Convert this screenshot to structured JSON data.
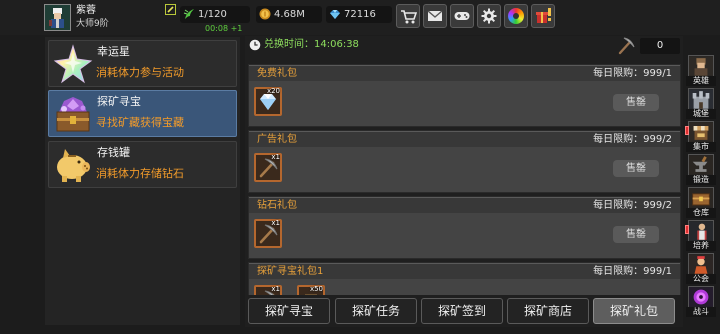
{
  "player": {
    "name": "紫蓉",
    "rank": "大师9阶",
    "icon": "hero-avatar-icon"
  },
  "resources": {
    "stamina": {
      "value": "1/120",
      "regen": "00:08 +1",
      "icon": "stamina-icon"
    },
    "gold": {
      "value": "4.68M",
      "icon": "gold-coin-icon"
    },
    "gems": {
      "value": "72116",
      "icon": "gem-icon"
    }
  },
  "toolbar_icons": [
    "shop-cart-icon",
    "mail-icon",
    "gamepad-icon",
    "settings-gear-icon",
    "color-palette-icon",
    "gift-alert-icon"
  ],
  "activities": [
    {
      "title": "幸运星",
      "subtitle": "消耗体力参与活动",
      "icon": "lucky-star-icon",
      "selected": false
    },
    {
      "title": "探矿寻宝",
      "subtitle": "寻找矿藏获得宝藏",
      "icon": "treasure-chest-icon",
      "selected": true
    },
    {
      "title": "存钱罐",
      "subtitle": "消耗体力存储钻石",
      "icon": "piggy-bank-icon",
      "selected": false
    }
  ],
  "exchange": {
    "label": "兑换时间：",
    "time": "14:06:38",
    "icon": "clock-icon"
  },
  "pickaxe": {
    "icon": "pickaxe-icon",
    "count": "0"
  },
  "packs": [
    {
      "name": "免费礼包",
      "limit": "每日限购：999/1",
      "items": [
        {
          "icon": "diamond-icon",
          "qty": "x20"
        }
      ],
      "button": "售罄"
    },
    {
      "name": "广告礼包",
      "limit": "每日限购：999/2",
      "items": [
        {
          "icon": "pickaxe-icon",
          "qty": "x1"
        }
      ],
      "button": "售罄"
    },
    {
      "name": "钻石礼包",
      "limit": "每日限购：999/2",
      "items": [
        {
          "icon": "pickaxe-icon",
          "qty": "x1"
        }
      ],
      "button": "售罄"
    },
    {
      "name": "探矿寻宝礼包1",
      "limit": "每日限购：999/1",
      "items": [
        {
          "icon": "pickaxe-icon",
          "qty": "x1"
        },
        {
          "icon": "reward-item-icon",
          "qty": "x50"
        }
      ]
    }
  ],
  "tabs": [
    {
      "label": "探矿寻宝",
      "selected": false
    },
    {
      "label": "探矿任务",
      "selected": false
    },
    {
      "label": "探矿签到",
      "selected": false
    },
    {
      "label": "探矿商店",
      "selected": false
    },
    {
      "label": "探矿礼包",
      "selected": true
    }
  ],
  "sidebar": [
    {
      "label": "英雄",
      "icon": "hero-icon",
      "alert": false
    },
    {
      "label": "城堡",
      "icon": "castle-icon",
      "alert": false
    },
    {
      "label": "集市",
      "icon": "market-icon",
      "alert": true
    },
    {
      "label": "锻造",
      "icon": "forge-anvil-icon",
      "alert": false
    },
    {
      "label": "仓库",
      "icon": "warehouse-chest-icon",
      "alert": false
    },
    {
      "label": "培养",
      "icon": "training-icon",
      "alert": true
    },
    {
      "label": "公会",
      "icon": "guild-icon",
      "alert": false
    },
    {
      "label": "战斗",
      "icon": "battle-portal-icon",
      "alert": false
    }
  ],
  "theme": {
    "pack_title": "#eaa23a",
    "subtitle_orange": "#f29b2a",
    "timer_green": "#8ede5e",
    "selected_blue": "#3a5679",
    "alert_red": "#e03030"
  }
}
